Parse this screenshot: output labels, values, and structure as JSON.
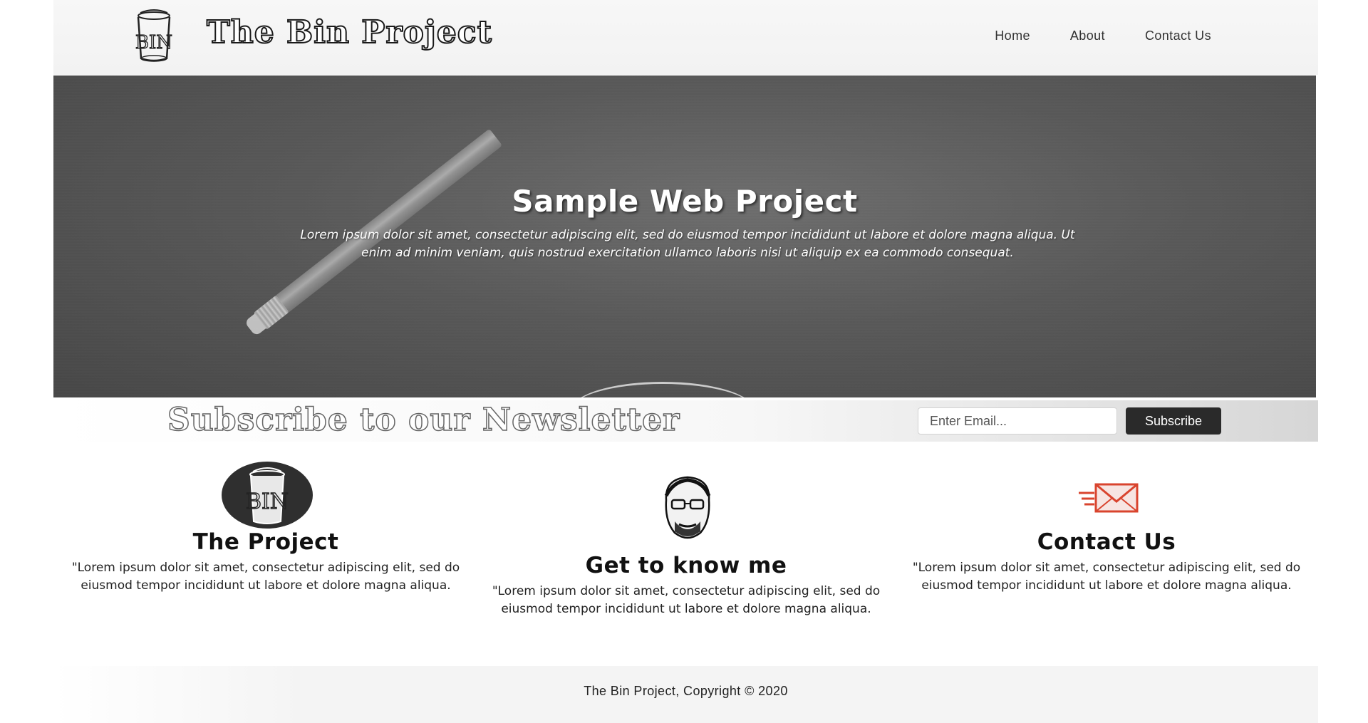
{
  "header": {
    "site_title": "The Bin Project",
    "logo_text": "BIN",
    "nav": [
      "Home",
      "About",
      "Contact Us"
    ]
  },
  "hero": {
    "title": "Sample Web Project",
    "text": "Lorem ipsum dolor sit amet, consectetur adipiscing elit, sed do eiusmod tempor incididunt ut labore et dolore magna aliqua. Ut enim ad minim veniam, quis nostrud exercitation ullamco laboris nisi ut aliquip ex ea commodo consequat."
  },
  "newsletter": {
    "title": "Subscribe to our Newsletter",
    "email_placeholder": "Enter Email...",
    "button_label": "Subscribe"
  },
  "features": [
    {
      "icon": "bin-logo-icon",
      "title": "The Project",
      "text": "\"Lorem ipsum dolor sit amet, consectetur adipiscing elit, sed do eiusmod tempor incididunt ut labore et dolore magna aliqua."
    },
    {
      "icon": "portrait-icon",
      "title": "Get to know me",
      "text": "\"Lorem ipsum dolor sit amet, consectetur adipiscing elit, sed do eiusmod tempor incididunt ut labore et dolore magna aliqua."
    },
    {
      "icon": "mail-icon",
      "title": "Contact Us",
      "text": "\"Lorem ipsum dolor sit amet, consectetur adipiscing elit, sed do eiusmod tempor incididunt ut labore et dolore magna aliqua."
    }
  ],
  "footer": {
    "text": "The Bin Project, Copyright © 2020"
  },
  "colors": {
    "header_bg": "#f5f5f5",
    "hero_bg": "#595959",
    "button_bg": "#2a2a2a",
    "mail_icon_red": "#d9442e"
  }
}
